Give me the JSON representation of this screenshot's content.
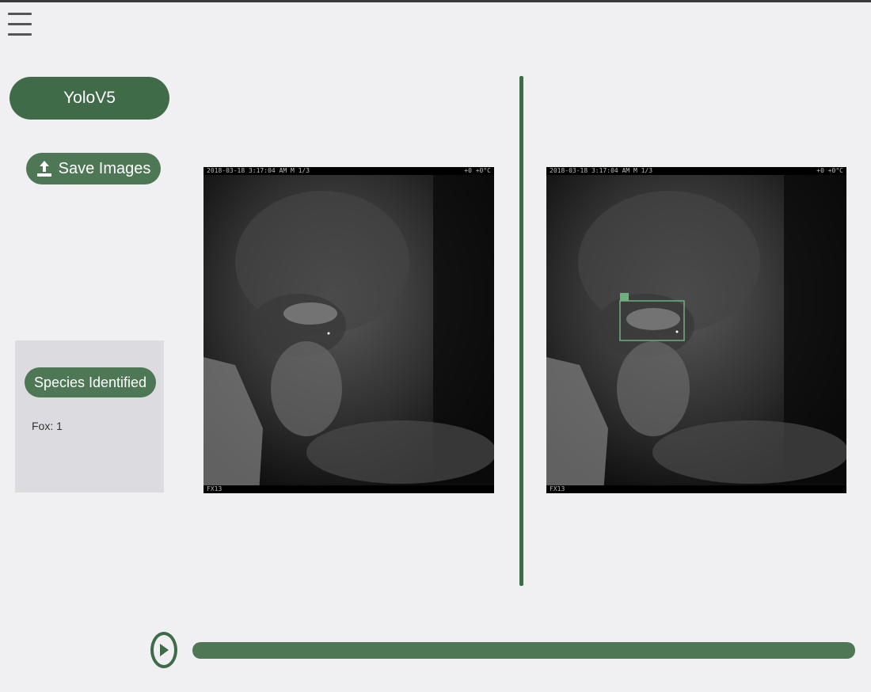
{
  "menu": {
    "icon": "hamburger-icon"
  },
  "model_button": {
    "label": "YoloV5"
  },
  "save_button": {
    "label": "Save Images",
    "icon": "upload-icon"
  },
  "species_panel": {
    "title": "Species Identified",
    "count_text": "Fox: 1"
  },
  "images": {
    "original": {
      "icon": "camera-trap-image",
      "overlay_top_left": "2018-03-18 3:17:04 AM  M 1/3",
      "overlay_top_right": "+0 +0°C",
      "overlay_bottom": "FX13"
    },
    "detected": {
      "icon": "camera-trap-image",
      "overlay_top_left": "2018-03-18 3:17:04 AM  M 1/3",
      "overlay_top_right": "+0 +0°C",
      "overlay_bottom": "FX13",
      "detection_label": "fox"
    }
  },
  "playback": {
    "play_icon": "play-icon",
    "progress": 1.0
  },
  "colors": {
    "accent": "#3f6b48",
    "accent_light": "#4d7755",
    "background": "#f0f0f2",
    "panel": "#dcdce0"
  }
}
